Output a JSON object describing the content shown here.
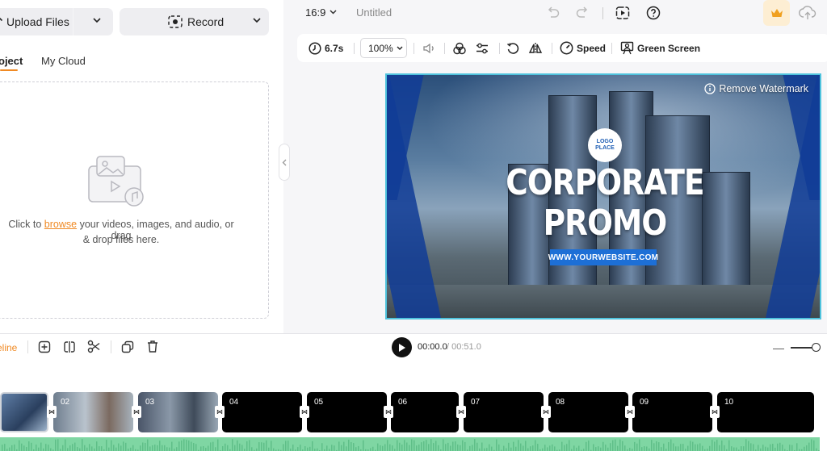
{
  "left_panel": {
    "upload_label": "Upload Files",
    "record_label": "Record",
    "tabs": [
      "oject",
      "My Cloud"
    ],
    "drop_text_pre": "Click to ",
    "drop_link": "browse",
    "drop_text_post": " your videos, images, and audio, or drag",
    "drop_text_line2": "& drop files here."
  },
  "topbar": {
    "aspect_ratio": "16:9",
    "project_title": "Untitled"
  },
  "toolbar": {
    "duration": "6.7s",
    "zoom": "100%",
    "speed_label": "Speed",
    "green_screen_label": "Green Screen"
  },
  "preview": {
    "logo_text_1": "LOGO",
    "logo_text_2": "PLACE",
    "headline_1": "CORPORATE",
    "headline_2": "PROMO",
    "website": "WWW.YOURWEBSITE.COM",
    "watermark_label": "Remove Watermark"
  },
  "timeline": {
    "label": "eline",
    "current_time": "00:00.0",
    "total_time": " / 00:51.0",
    "clips": [
      "",
      "02",
      "03",
      "04",
      "05",
      "06",
      "07",
      "08",
      "09",
      "10"
    ]
  },
  "colors": {
    "accent": "#f08a24",
    "selection": "#4fc3dd",
    "audio": "#7fd6a3",
    "premium_bg": "#fdeed3"
  }
}
